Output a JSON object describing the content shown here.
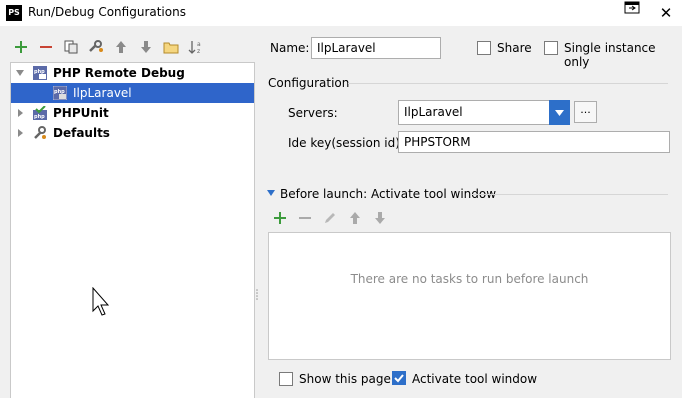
{
  "window": {
    "title": "Run/Debug Configurations",
    "app_logo": "PS"
  },
  "tree": {
    "items": [
      {
        "label": "PHP Remote Debug",
        "icon": "php-debug-icon",
        "expanded": true,
        "bold": true
      },
      {
        "label": "IlpLaravel",
        "icon": "php-config-icon",
        "selected": true
      },
      {
        "label": "PHPUnit",
        "icon": "phpunit-icon",
        "expanded": false,
        "bold": true
      },
      {
        "label": "Defaults",
        "icon": "wrench-icon",
        "expanded": false,
        "bold": true
      }
    ]
  },
  "form": {
    "name_label": "Name:",
    "name_value": "IlpLaravel",
    "share_label": "Share",
    "single_instance_label": "Single instance only",
    "configuration_header": "Configuration",
    "servers_label": "Servers:",
    "servers_value": "IlpLaravel",
    "browse_label": "...",
    "ide_key_label": "Ide key(session id):",
    "ide_key_value": "PHPSTORM",
    "before_launch_label": "Before launch: Activate tool window",
    "empty_tasks_text": "There are no tasks to run before launch",
    "show_page_label": "Show this page",
    "activate_tool_window_label": "Activate tool window",
    "share_checked": false,
    "single_instance_checked": false,
    "show_page_checked": false,
    "activate_tool_window_checked": true
  },
  "colors": {
    "selection": "#2f65ca",
    "add_green": "#3c9b3c",
    "remove_red": "#c84434",
    "accent_blue": "#2d6fc9"
  }
}
